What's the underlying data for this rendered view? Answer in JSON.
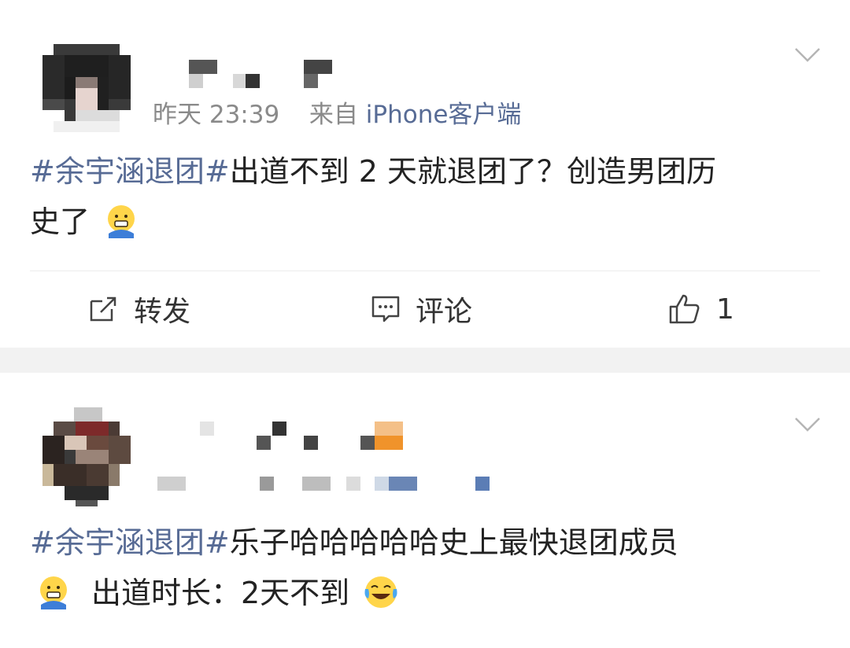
{
  "posts": [
    {
      "meta": {
        "time": "昨天 23:39",
        "from_label": "来自",
        "source": "iPhone客户端"
      },
      "content": {
        "hashtag": "#余宇涵退团#",
        "text_line1": "出道不到 2 天就退团了？创造男团历",
        "text_line2": "史了",
        "emoji": "smile-face-icon"
      },
      "actions": {
        "repost": "转发",
        "comment": "评论",
        "like_count": "1"
      }
    },
    {
      "content": {
        "hashtag": "#余宇涵退团#",
        "text_line1": "乐子哈哈哈哈哈史上最快退团成员",
        "text_line2": "出道时长：2天不到",
        "emoji1": "smile-face-icon",
        "emoji2": "laughing-tears-icon"
      }
    }
  ],
  "colors": {
    "link": "#576b95",
    "meta": "#8a8a8a",
    "text": "#222222",
    "separator": "#f2f2f2"
  }
}
